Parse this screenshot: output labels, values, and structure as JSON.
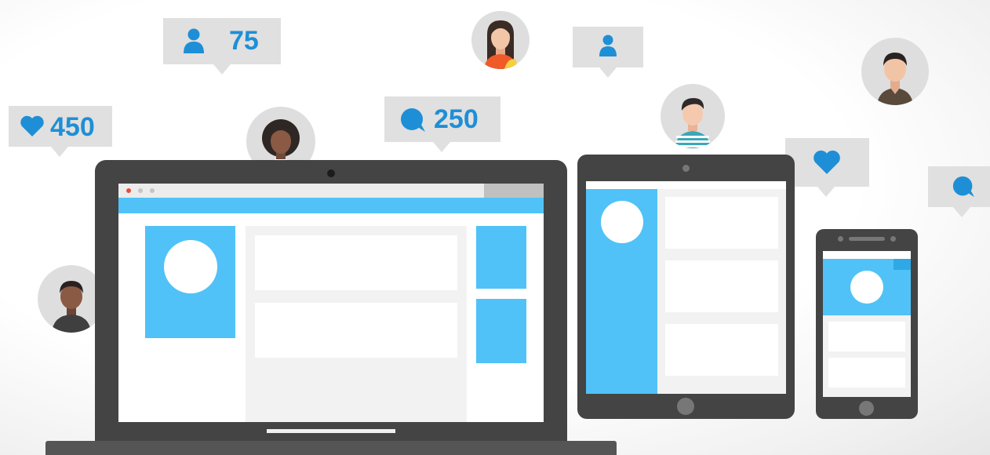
{
  "badges": {
    "followers": {
      "icon": "person-icon",
      "count": "75"
    },
    "likes": {
      "icon": "heart-icon",
      "count": "450"
    },
    "comments": {
      "icon": "comment-icon",
      "count": "250"
    },
    "profile_small": {
      "icon": "person-icon"
    },
    "like_small": {
      "icon": "heart-icon"
    },
    "comment_small": {
      "icon": "comment-icon"
    }
  },
  "colors": {
    "accent_blue": "#1e8fd6",
    "panel_blue": "#50c2f7",
    "device_frame": "#444444",
    "bubble_gray": "#e0e0e0"
  },
  "devices": [
    "laptop",
    "tablet",
    "phone"
  ]
}
